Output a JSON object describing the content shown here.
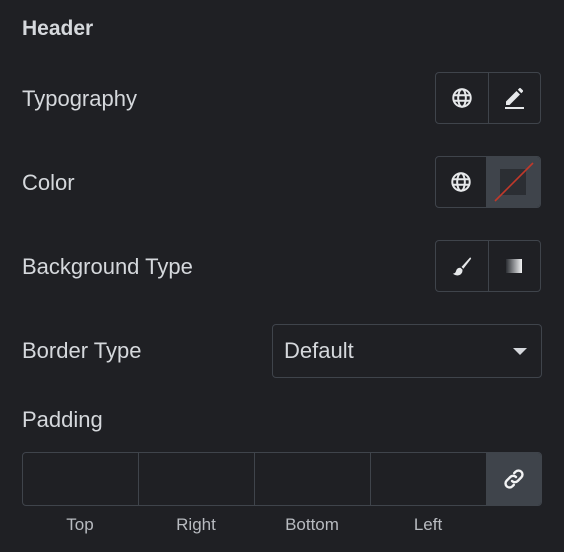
{
  "section": {
    "title": "Header"
  },
  "typography": {
    "label": "Typography",
    "buttons": [
      {
        "icon": "globe-icon"
      },
      {
        "icon": "pencil-icon"
      }
    ]
  },
  "color": {
    "label": "Color",
    "buttons": [
      {
        "icon": "globe-icon"
      },
      {
        "icon": "no-color-swatch-icon",
        "active": true
      }
    ],
    "swatch_slash_color": "#c0392b"
  },
  "background_type": {
    "label": "Background Type",
    "buttons": [
      {
        "icon": "brush-icon"
      },
      {
        "icon": "gradient-icon"
      }
    ]
  },
  "border_type": {
    "label": "Border Type",
    "value": "Default"
  },
  "padding": {
    "label": "Padding",
    "fields": [
      {
        "label": "Top",
        "value": ""
      },
      {
        "label": "Right",
        "value": ""
      },
      {
        "label": "Bottom",
        "value": ""
      },
      {
        "label": "Left",
        "value": ""
      }
    ],
    "link_icon": "link-icon"
  },
  "colors": {
    "background": "#1f2024",
    "text": "#d5d8dc",
    "border": "#3f444b",
    "active_bg": "#3f444b"
  }
}
